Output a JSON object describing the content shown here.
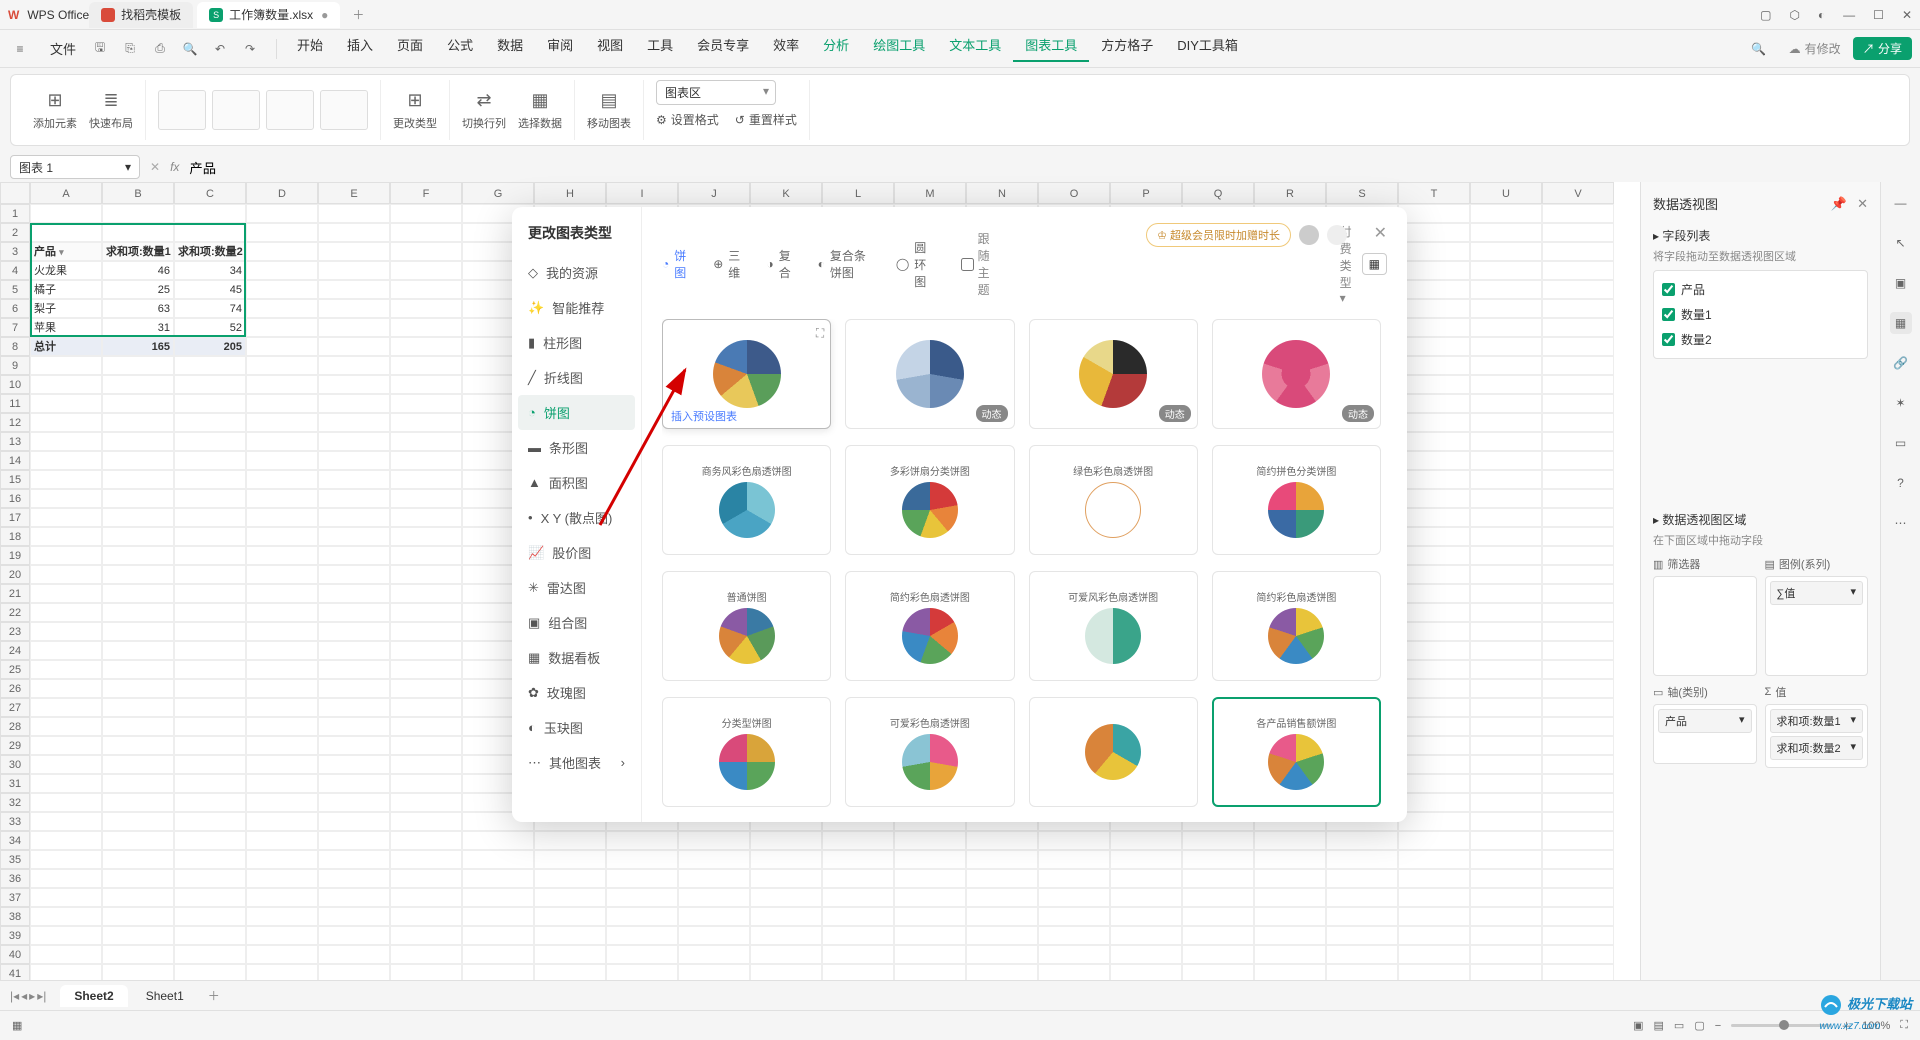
{
  "app": {
    "name": "WPS Office"
  },
  "titlebar_tabs": [
    {
      "label": "找稻壳模板",
      "icon_color": "#d94b3a"
    },
    {
      "label": "工作簿数量.xlsx",
      "icon_color": "#0aa06e",
      "active": true
    }
  ],
  "file_menu": "文件",
  "menus": [
    "开始",
    "插入",
    "页面",
    "公式",
    "数据",
    "审阅",
    "视图",
    "工具",
    "会员专享",
    "效率",
    "分析",
    "绘图工具",
    "文本工具",
    "图表工具",
    "方方格子",
    "DIY工具箱"
  ],
  "menu_active": "图表工具",
  "menu_accents": [
    "分析",
    "绘图工具",
    "文本工具",
    "图表工具"
  ],
  "modify_label": "有修改",
  "share_label": "分享",
  "ribbon": {
    "add_element": "添加元素",
    "quick_layout": "快速布局",
    "change_type": "更改类型",
    "swap_rowcol": "切换行列",
    "select_data": "选择数据",
    "move_chart": "移动图表",
    "area_dropdown": "图表区",
    "format_sel": "设置格式",
    "reset_style": "重置样式"
  },
  "namebox": "图表 1",
  "formula": "产品",
  "cols": [
    "A",
    "B",
    "C",
    "D",
    "E",
    "F",
    "G",
    "H",
    "I",
    "J",
    "K",
    "L",
    "M",
    "N",
    "O",
    "P",
    "Q",
    "R",
    "S",
    "T",
    "U",
    "V"
  ],
  "table": {
    "headers": [
      "产品",
      "求和项:数量1",
      "求和项:数量2"
    ],
    "rows": [
      [
        "火龙果",
        "46",
        "34"
      ],
      [
        "橘子",
        "25",
        "45"
      ],
      [
        "梨子",
        "63",
        "74"
      ],
      [
        "苹果",
        "31",
        "52"
      ]
    ],
    "total": [
      "总计",
      "165",
      "205"
    ]
  },
  "modal": {
    "title": "更改图表类型",
    "promo": "超级会员限时加赠时长",
    "side_items": [
      "我的资源",
      "智能推荐",
      "柱形图",
      "折线图",
      "饼图",
      "条形图",
      "面积图",
      "X Y (散点图)",
      "股价图",
      "雷达图",
      "组合图",
      "数据看板",
      "玫瑰图",
      "玉玦图",
      "其他图表"
    ],
    "side_active": "饼图",
    "tabs": [
      "饼图",
      "三维",
      "复合",
      "复合条饼图",
      "圆环图"
    ],
    "tab_active": "饼图",
    "follow_theme": "跟随主题",
    "paid_label": "付费类型",
    "hover_caption": "插入预设图表",
    "badges": [
      "动态",
      "动态",
      "动态"
    ],
    "card_titles": [
      "商务风彩色扇透饼图",
      "多彩饼扇分类饼图",
      "绿色彩色扇透饼图",
      "简约拼色分类饼图",
      "普通饼图",
      "简约彩色扇透饼图",
      "可爱风彩色扇透饼图",
      "简约彩色扇透饼图",
      "分类型饼图",
      "可爱彩色扇透饼图",
      "",
      "各产品销售额饼图"
    ]
  },
  "pivot_panel": {
    "title": "数据透视图",
    "section_fields": "字段列表",
    "hint": "将字段拖动至数据透视图区域",
    "fields": [
      "产品",
      "数量1",
      "数量2"
    ],
    "section_areas": "数据透视图区域",
    "hint2": "在下面区域中拖动字段",
    "labels": {
      "filter": "筛选器",
      "legend": "图例(系列)",
      "axis": "轴(类别)",
      "values": "值"
    },
    "legend_items": [
      "∑值"
    ],
    "axis_items": [
      "产品"
    ],
    "value_items": [
      "求和项:数量1",
      "求和项:数量2"
    ]
  },
  "sheet_tabs": [
    "Sheet2",
    "Sheet1"
  ],
  "sheet_active": "Sheet2",
  "zoom": "100%",
  "watermark": "极光下载站",
  "watermark_url": "www.xz7.com",
  "chart_data": {
    "type": "pivot-source",
    "categories": [
      "火龙果",
      "橘子",
      "梨子",
      "苹果"
    ],
    "series": [
      {
        "name": "求和项:数量1",
        "values": [
          46,
          25,
          63,
          31
        ]
      },
      {
        "name": "求和项:数量2",
        "values": [
          34,
          45,
          74,
          52
        ]
      }
    ],
    "totals": {
      "数量1": 165,
      "数量2": 205
    }
  }
}
